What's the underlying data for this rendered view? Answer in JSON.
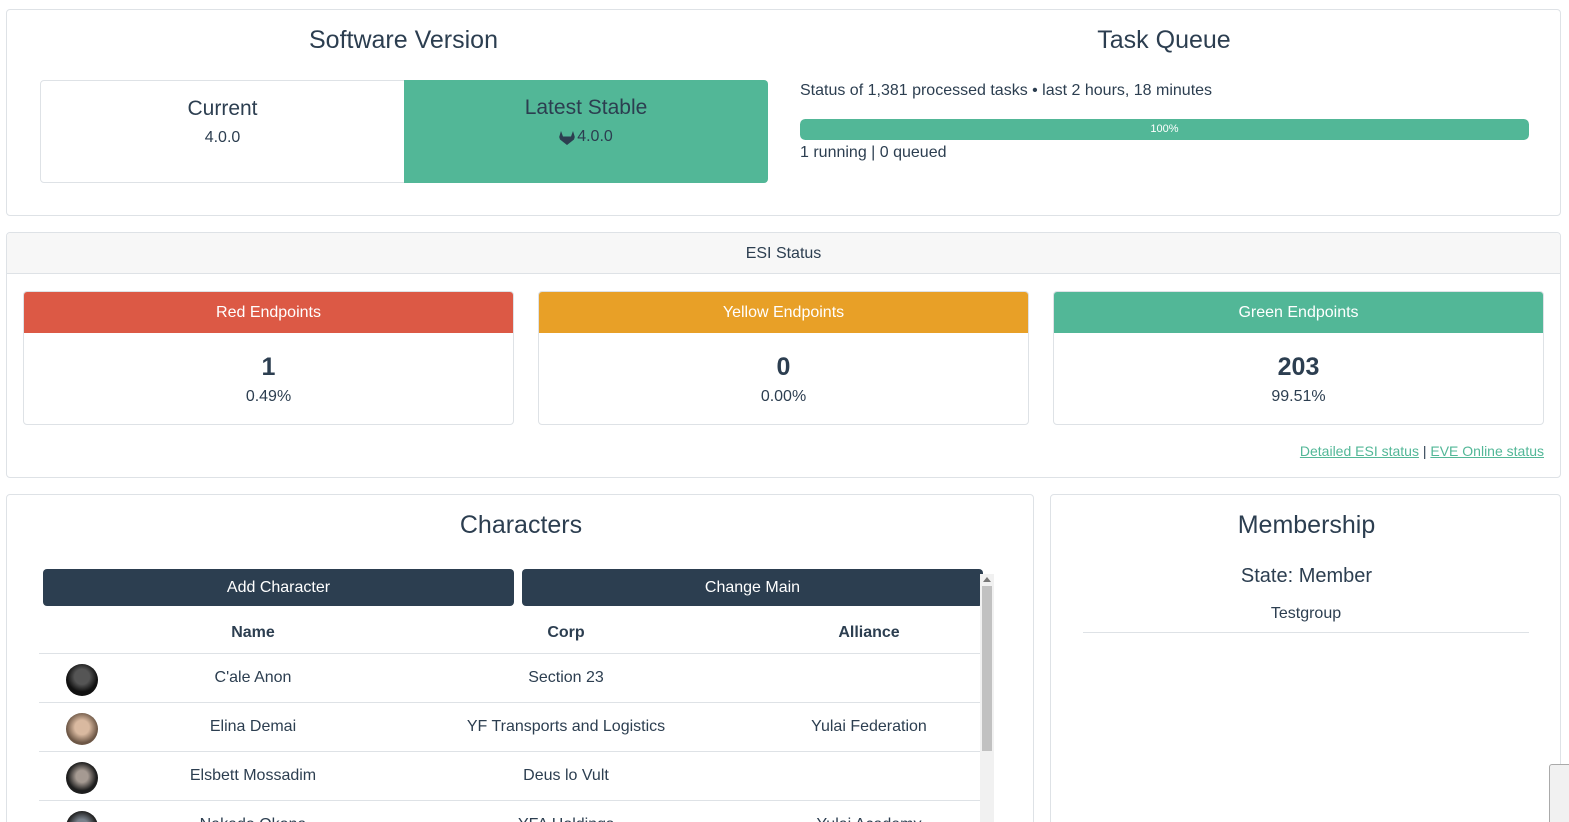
{
  "software": {
    "title": "Software Version",
    "current_label": "Current",
    "current_version": "4.0.0",
    "latest_label": "Latest Stable",
    "latest_version": "4.0.0",
    "latest_icon": "gitlab-icon",
    "accent_color": "#52b797"
  },
  "task_queue": {
    "title": "Task Queue",
    "status": "Status of 1,381 processed tasks • last 2 hours, 18 minutes",
    "progress_label": "100%",
    "progress_value": 1.0,
    "running": "1 running | 0 queued"
  },
  "esi": {
    "title": "ESI Status",
    "red": {
      "label": "Red Endpoints",
      "count": "1",
      "pct": "0.49%",
      "color": "#dc5945"
    },
    "yellow": {
      "label": "Yellow Endpoints",
      "count": "0",
      "pct": "0.00%",
      "color": "#e8a027"
    },
    "green": {
      "label": "Green Endpoints",
      "count": "203",
      "pct": "99.51%",
      "color": "#52b797"
    },
    "link_detailed": "Detailed ESI status",
    "link_separator": "|",
    "link_eve": "EVE Online status"
  },
  "characters": {
    "title": "Characters",
    "add_button": "Add Character",
    "change_main_button": "Change Main",
    "columns": [
      "Name",
      "Corp",
      "Alliance"
    ],
    "rows": [
      {
        "name": "C'ale Anon",
        "corp": "Section 23",
        "alliance": ""
      },
      {
        "name": "Elina Demai",
        "corp": "YF Transports and Logistics",
        "alliance": "Yulai Federation"
      },
      {
        "name": "Elsbett Mossadim",
        "corp": "Deus lo Vult",
        "alliance": ""
      },
      {
        "name": "Nakado Okona",
        "corp": "YFA Holdings",
        "alliance": "Yulai Academy"
      }
    ]
  },
  "membership": {
    "title": "Membership",
    "state": "State: Member",
    "group": "Testgroup"
  }
}
